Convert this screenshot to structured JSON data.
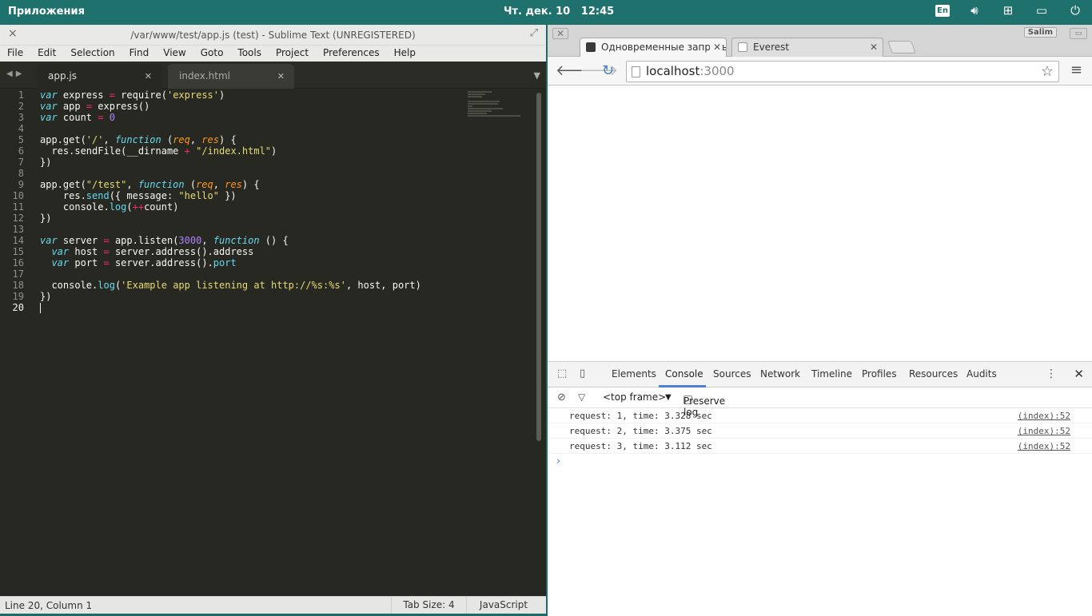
{
  "topbar": {
    "apps": "Приложения",
    "clock": "Чт. дек. 10   12:45",
    "lang": "En"
  },
  "sublime": {
    "title": "/var/www/test/app.js (test) - Sublime Text (UNREGISTERED)",
    "menu": [
      "File",
      "Edit",
      "Selection",
      "Find",
      "View",
      "Goto",
      "Tools",
      "Project",
      "Preferences",
      "Help"
    ],
    "tabs": [
      {
        "label": "app.js"
      },
      {
        "label": "index.html"
      }
    ],
    "status": {
      "position": "Line 20, Column 1",
      "tab_size": "Tab Size: 4",
      "syntax": "JavaScript"
    }
  },
  "chrome": {
    "tabs": [
      {
        "label": "Одновременные запросы"
      },
      {
        "label": "Everest"
      }
    ],
    "user": "Salim",
    "url_host": "localhost",
    "url_port": ":3000",
    "devtools": {
      "tabs": [
        "Elements",
        "Console",
        "Sources",
        "Network",
        "Timeline",
        "Profiles",
        "Resources",
        "Audits"
      ],
      "frame": "<top frame>",
      "preserve_log": "Preserve log",
      "logs": [
        {
          "text": "request: 1, time: 3.328 sec",
          "src": "(index):52"
        },
        {
          "text": "request: 2, time: 3.375 sec",
          "src": "(index):52"
        },
        {
          "text": "request: 3, time: 3.112 sec",
          "src": "(index):52"
        }
      ],
      "prompt": "›"
    }
  },
  "colors": {
    "accent": "#1f716d",
    "editor_bg": "#272822",
    "devtools_active": "#4c80d6"
  }
}
